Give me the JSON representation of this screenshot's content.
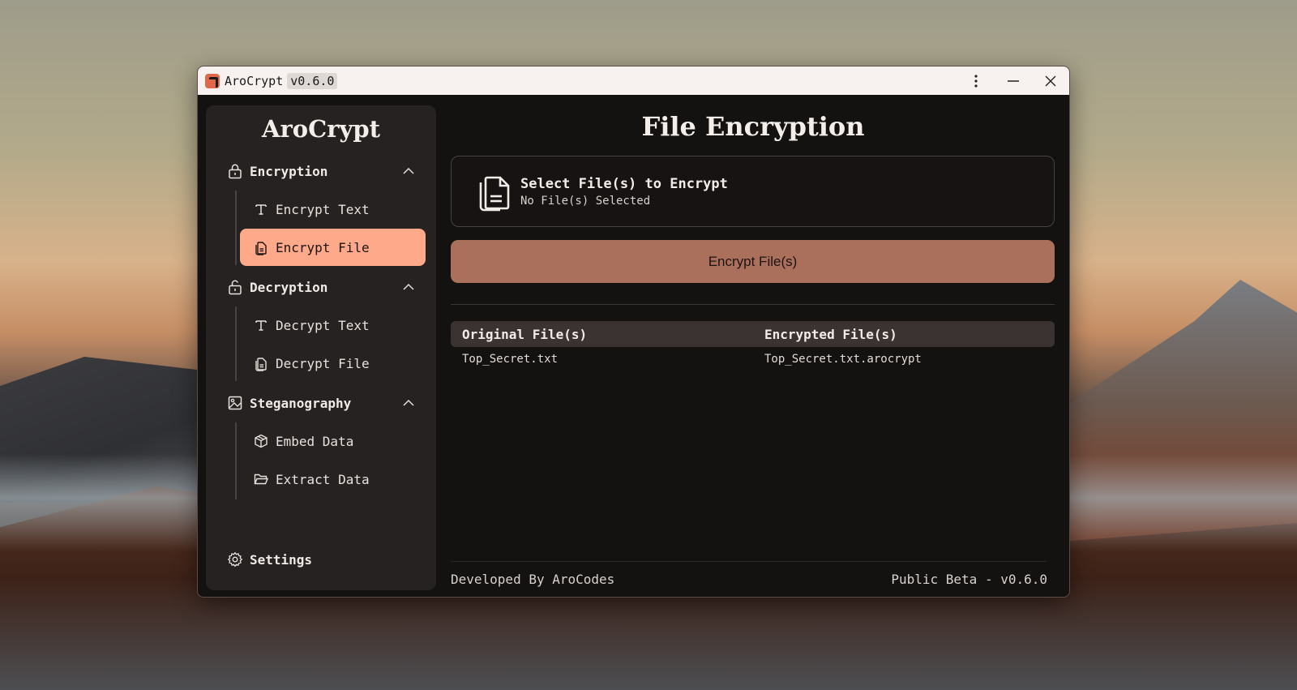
{
  "window": {
    "title": "AroCrypt",
    "version": "v0.6.0",
    "controls": [
      "more-options",
      "minimize",
      "close"
    ]
  },
  "sidebar": {
    "brand": "AroCrypt",
    "sections": [
      {
        "label": "Encryption",
        "icon": "lock-icon",
        "expanded": true,
        "items": [
          {
            "label": "Encrypt Text",
            "icon": "text-icon",
            "active": false
          },
          {
            "label": "Encrypt File",
            "icon": "file-icon",
            "active": true
          }
        ]
      },
      {
        "label": "Decryption",
        "icon": "unlock-icon",
        "expanded": true,
        "items": [
          {
            "label": "Decrypt Text",
            "icon": "text-icon",
            "active": false
          },
          {
            "label": "Decrypt File",
            "icon": "file-icon",
            "active": false
          }
        ]
      },
      {
        "label": "Steganography",
        "icon": "image-icon",
        "expanded": true,
        "items": [
          {
            "label": "Embed Data",
            "icon": "box-icon",
            "active": false
          },
          {
            "label": "Extract Data",
            "icon": "folder-open-icon",
            "active": false
          }
        ]
      }
    ],
    "settings_label": "Settings"
  },
  "main": {
    "title": "File Encryption",
    "select_card": {
      "title": "Select File(s) to Encrypt",
      "subtitle": "No File(s) Selected",
      "icon": "files-icon"
    },
    "encrypt_button": "Encrypt File(s)",
    "table": {
      "headers": [
        "Original File(s)",
        "Encrypted File(s)"
      ],
      "rows": [
        [
          "Top_Secret.txt",
          "Top_Secret.txt.arocrypt"
        ]
      ]
    },
    "footer": {
      "left": "Developed By AroCodes",
      "right": "Public Beta - v0.6.0"
    }
  },
  "colors": {
    "accent": "#fea98a",
    "button": "#ab705c",
    "sidebar_bg": "#262221",
    "window_bg": "#141111"
  }
}
